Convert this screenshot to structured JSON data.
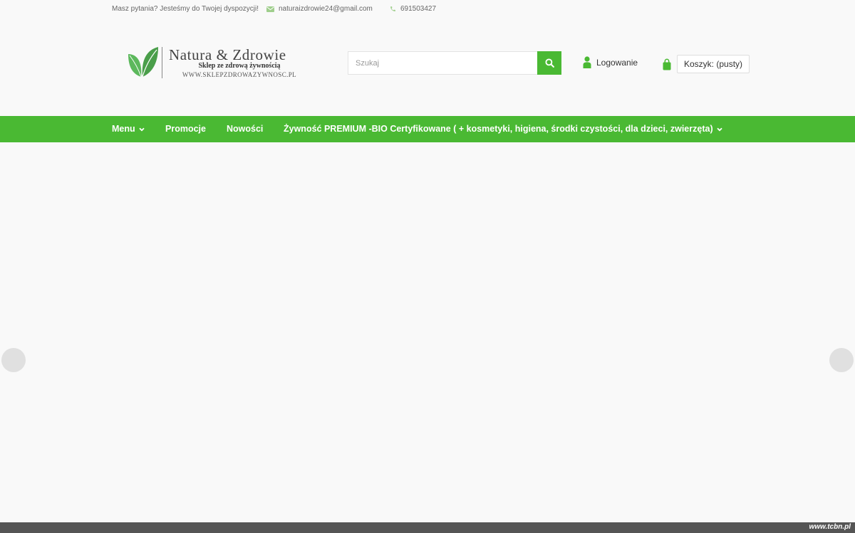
{
  "topbar": {
    "question": "Masz pytania? Jesteśmy do Twojej dyspozycji!",
    "email": "naturaizdrowie24@gmail.com",
    "phone": "691503427",
    "email_icon": "envelope-icon",
    "phone_icon": "phone-icon"
  },
  "logo": {
    "brand": "Natura & Zdrowie",
    "tagline": "Sklep ze zdrową żywnością",
    "url": "WWW.SKLEPZDROWAZYWNOSC.PL",
    "icon": "leaves-icon"
  },
  "search": {
    "placeholder": "Szukaj",
    "button_icon": "search-icon"
  },
  "account": {
    "login_label": "Logowanie",
    "icon": "user-icon"
  },
  "cart": {
    "label": "Koszyk: (pusty)",
    "icon": "shopping-bag-icon"
  },
  "nav": {
    "items": [
      {
        "label": "Menu",
        "has_dropdown": true
      },
      {
        "label": "Promocje",
        "has_dropdown": false
      },
      {
        "label": "Nowości",
        "has_dropdown": false
      },
      {
        "label": "Żywność PREMIUM -BIO Certyfikowane ( + kosmetyki, higiena, środki czystości, dla dzieci, zwierzęta)",
        "has_dropdown": true
      }
    ]
  },
  "slider": {
    "prev_icon": "slider-prev-arrow",
    "next_icon": "slider-next-arrow"
  },
  "footer": {
    "watermark": "www.tcbn.pl"
  },
  "colors": {
    "accent": "#4ab933",
    "background": "#f9f9f9",
    "icon_muted": "#9fce8c"
  }
}
